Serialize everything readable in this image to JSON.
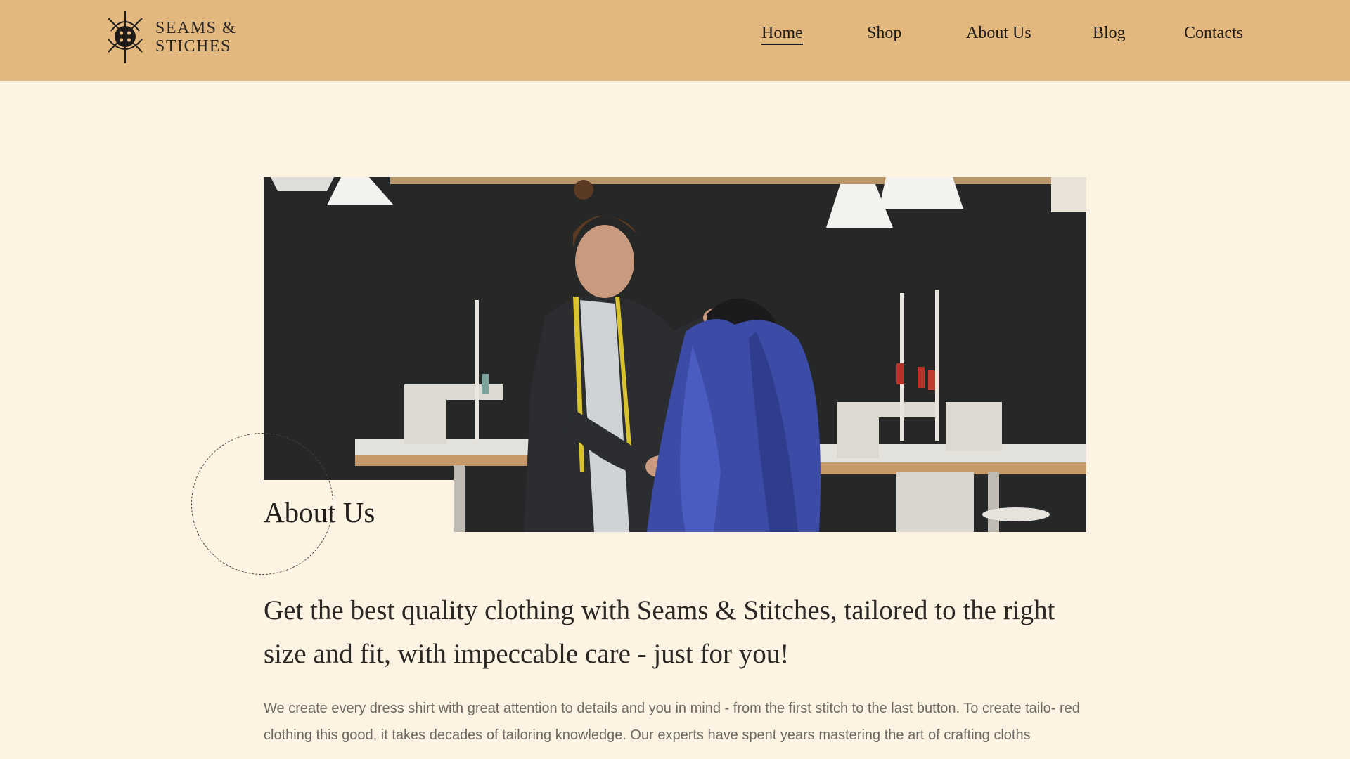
{
  "brand": {
    "name_line1": "SEAMS &",
    "name_line2": "STICHES",
    "logo_icon": "button-needle-crest-icon"
  },
  "nav": {
    "items": [
      {
        "label": "Home",
        "active": true
      },
      {
        "label": "Shop",
        "active": false
      },
      {
        "label": "About Us",
        "active": false
      },
      {
        "label": "Blog",
        "active": false
      },
      {
        "label": "Contacts",
        "active": false
      }
    ]
  },
  "hero": {
    "image_subject": "tailor-draping-blue-fabric-on-mannequin"
  },
  "about": {
    "title": "About Us",
    "lead": "Get the best quality clothing with Seams & Stitches, tailored to the right size and fit, with impeccable care - just for you!",
    "body": "We create every dress shirt with great attention to details and you in mind - from the first stitch to the last button. To create tailo- red clothing this good, it takes decades of tailoring knowledge. Our experts have spent years mastering the art of crafting cloths"
  },
  "colors": {
    "header_bg": "#e2b87f",
    "page_bg": "#fdf3e2",
    "text_dark": "#2a2624",
    "text_muted": "#6e6963"
  }
}
